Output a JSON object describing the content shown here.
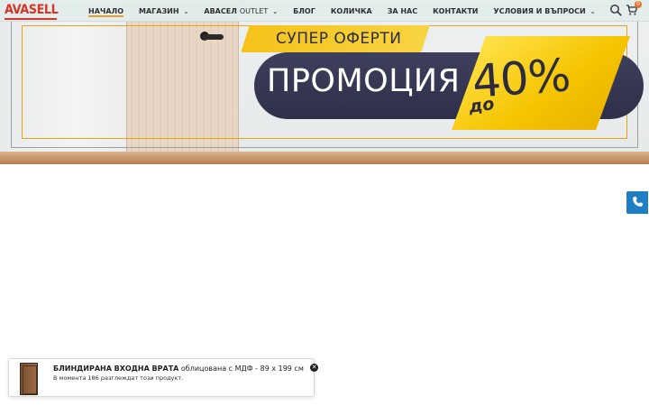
{
  "header": {
    "logo": "AVASELL",
    "nav": [
      {
        "label": "НАЧАЛО",
        "active": true
      },
      {
        "label": "МАГАЗИН",
        "dropdown": true
      },
      {
        "label": "АВАСЕЛ",
        "label_light": "OUTLET",
        "dropdown": true
      },
      {
        "label": "БЛОГ"
      },
      {
        "label": "КОЛИЧКА"
      },
      {
        "label": "ЗА НАС"
      },
      {
        "label": "КОНТАКТИ"
      },
      {
        "label": "УСЛОВИЯ И ВЪПРОСИ",
        "dropdown": true
      }
    ],
    "cart_count": "0",
    "icons": [
      "search-icon",
      "cart-icon"
    ]
  },
  "banner": {
    "tag": "СУПЕР ОФЕРТИ",
    "headline": "ПРОМОЦИЯ",
    "prefix": "до",
    "discount": "40%"
  },
  "contact": {
    "icon": "phone-icon",
    "color": "#1f7ec4"
  },
  "popup": {
    "title_bold": "БЛИНДИРАНА ВХОДНА ВРАТА",
    "title_rest": " облицована с МДФ - 89 х 199 см",
    "subtitle": "В момента 186 разглеждат този продукт.",
    "close_symbol": "✕"
  },
  "colors": {
    "brand": "#d8352a",
    "accent": "#e89a2a",
    "promo_dark": "#2e304a",
    "promo_yellow": "#f5c400"
  }
}
